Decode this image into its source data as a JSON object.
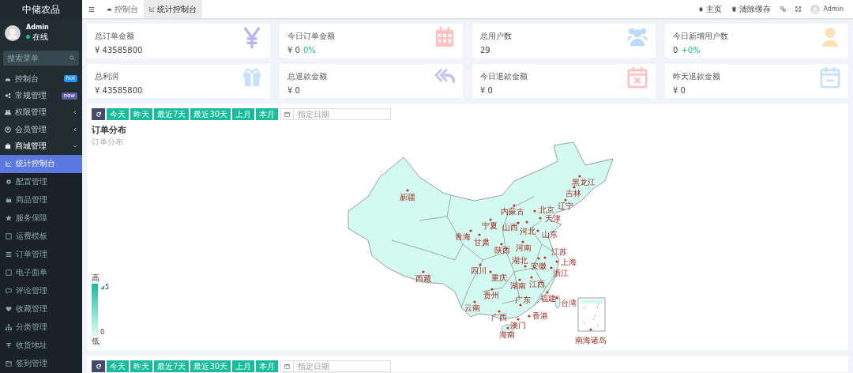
{
  "sidebar": {
    "logo": "中储农品",
    "user": {
      "name": "Admin",
      "status": "在线"
    },
    "search": {
      "placeholder": "搜索菜单"
    },
    "items": [
      {
        "label": "控制台",
        "selected": false,
        "badge": {
          "text": "hot",
          "color": "#1e90ff"
        }
      },
      {
        "label": "常规管理",
        "selected": false,
        "badge": {
          "text": "new",
          "color": "#605ca8"
        }
      },
      {
        "label": "权限管理",
        "selected": false,
        "expanded": false
      },
      {
        "label": "会员管理",
        "selected": false,
        "expanded": false
      },
      {
        "label": "商城管理",
        "selected": false,
        "expanded": true,
        "children": [
          {
            "label": "统计控制台",
            "selected": true
          },
          {
            "label": "配置管理",
            "selected": false
          },
          {
            "label": "商品管理",
            "selected": false
          },
          {
            "label": "服务保障",
            "selected": false
          },
          {
            "label": "运费模板",
            "selected": false
          },
          {
            "label": "订单管理",
            "selected": false
          },
          {
            "label": "电子面单",
            "selected": false
          },
          {
            "label": "评论管理",
            "selected": false
          },
          {
            "label": "收藏管理",
            "selected": false
          },
          {
            "label": "分类管理",
            "selected": false
          },
          {
            "label": "收货地址",
            "selected": false
          },
          {
            "label": "签到管理",
            "selected": false
          }
        ]
      }
    ]
  },
  "header": {
    "tabs": [
      {
        "label": "控制台",
        "selected": false
      },
      {
        "label": "统计控制台",
        "selected": true
      }
    ],
    "links": [
      {
        "label": "主页"
      },
      {
        "label": "清除缓存"
      }
    ],
    "user": "Admin"
  },
  "stats": [
    {
      "label": "总订单金额",
      "value": "¥ 43585800"
    },
    {
      "label": "今日订单金额",
      "value": "¥ 0",
      "change": "0%"
    },
    {
      "label": "总用户数",
      "value": "29"
    },
    {
      "label": "今日新增用户数",
      "value": "0",
      "change": "+0%"
    },
    {
      "label": "总利润",
      "value": "¥ 43585800"
    },
    {
      "label": "总退款金额",
      "value": "¥ 0"
    },
    {
      "label": "今日退款金额",
      "value": "¥ 0"
    },
    {
      "label": "昨天退款金额",
      "value": "¥ 0"
    }
  ],
  "panels": [
    {
      "filters": [
        "今天",
        "昨天",
        "最近7天",
        "最近30天",
        "上月",
        "本月"
      ],
      "date_placeholder": "指定日期",
      "title": "订单分布",
      "subtitle": "订单分布",
      "legend": {
        "high": "高",
        "max": "5",
        "low": "低",
        "min": "0"
      },
      "provinces": [
        "新疆",
        "西藏",
        "青海",
        "甘肃",
        "宁夏",
        "内蒙古",
        "黑龙江",
        "吉林",
        "辽宁",
        "北京",
        "天津",
        "山西",
        "河北",
        "山东",
        "陕西",
        "河南",
        "四川",
        "重庆",
        "湖北",
        "安徽",
        "江苏",
        "上海",
        "浙江",
        "湖南",
        "江西",
        "贵州",
        "云南",
        "广西",
        "广东",
        "福建",
        "台湾",
        "香港",
        "澳门",
        "海南",
        "南海诸岛"
      ]
    },
    {
      "filters": [
        "今天",
        "昨天",
        "最近7天",
        "最近30天",
        "上月",
        "本月"
      ],
      "date_placeholder": "指定日期"
    }
  ]
}
